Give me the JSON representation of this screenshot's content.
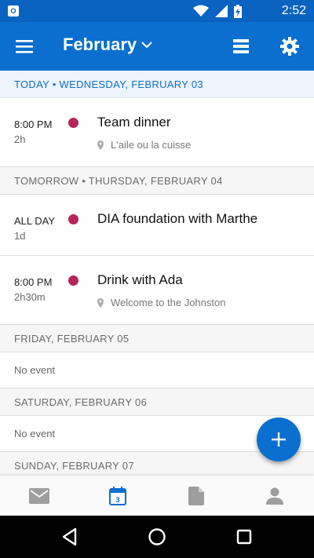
{
  "status_bar": {
    "app_badge": "O",
    "time": "2:52"
  },
  "app_bar": {
    "title": "February"
  },
  "days": [
    {
      "header": "TODAY • WEDNESDAY, FEBRUARY 03"
    },
    {
      "header": "TOMORROW • THURSDAY, FEBRUARY 04"
    },
    {
      "header": "FRIDAY, FEBRUARY 05"
    },
    {
      "header": "SATURDAY, FEBRUARY 06"
    },
    {
      "header": "SUNDAY, FEBRUARY 07"
    }
  ],
  "events": [
    {
      "time": "8:00 PM",
      "duration": "2h",
      "title": "Team dinner",
      "location": "L'aile ou la cuisse"
    },
    {
      "time": "ALL DAY",
      "duration": "1d",
      "title": "DIA foundation with Marthe"
    },
    {
      "time": "8:00 PM",
      "duration": "2h30m",
      "title": "Drink with Ada",
      "location": "Welcome to the Johnston"
    }
  ],
  "no_event_label": "No event",
  "calendar_icon_day": "3",
  "colors": {
    "accent": "#0a6fce",
    "event_dot": "#b5245a",
    "status_bar": "#0a63c1"
  },
  "icons": {
    "status": [
      "outlook-icon",
      "wifi-icon",
      "signal-icon",
      "battery-icon"
    ],
    "app_bar": [
      "menu-icon",
      "chevron-down-icon",
      "list-view-icon",
      "settings-icon"
    ],
    "bottom_nav": [
      "mail-icon",
      "calendar-icon",
      "files-icon",
      "people-icon"
    ],
    "system_nav": [
      "back-icon",
      "home-icon",
      "recents-icon"
    ]
  }
}
